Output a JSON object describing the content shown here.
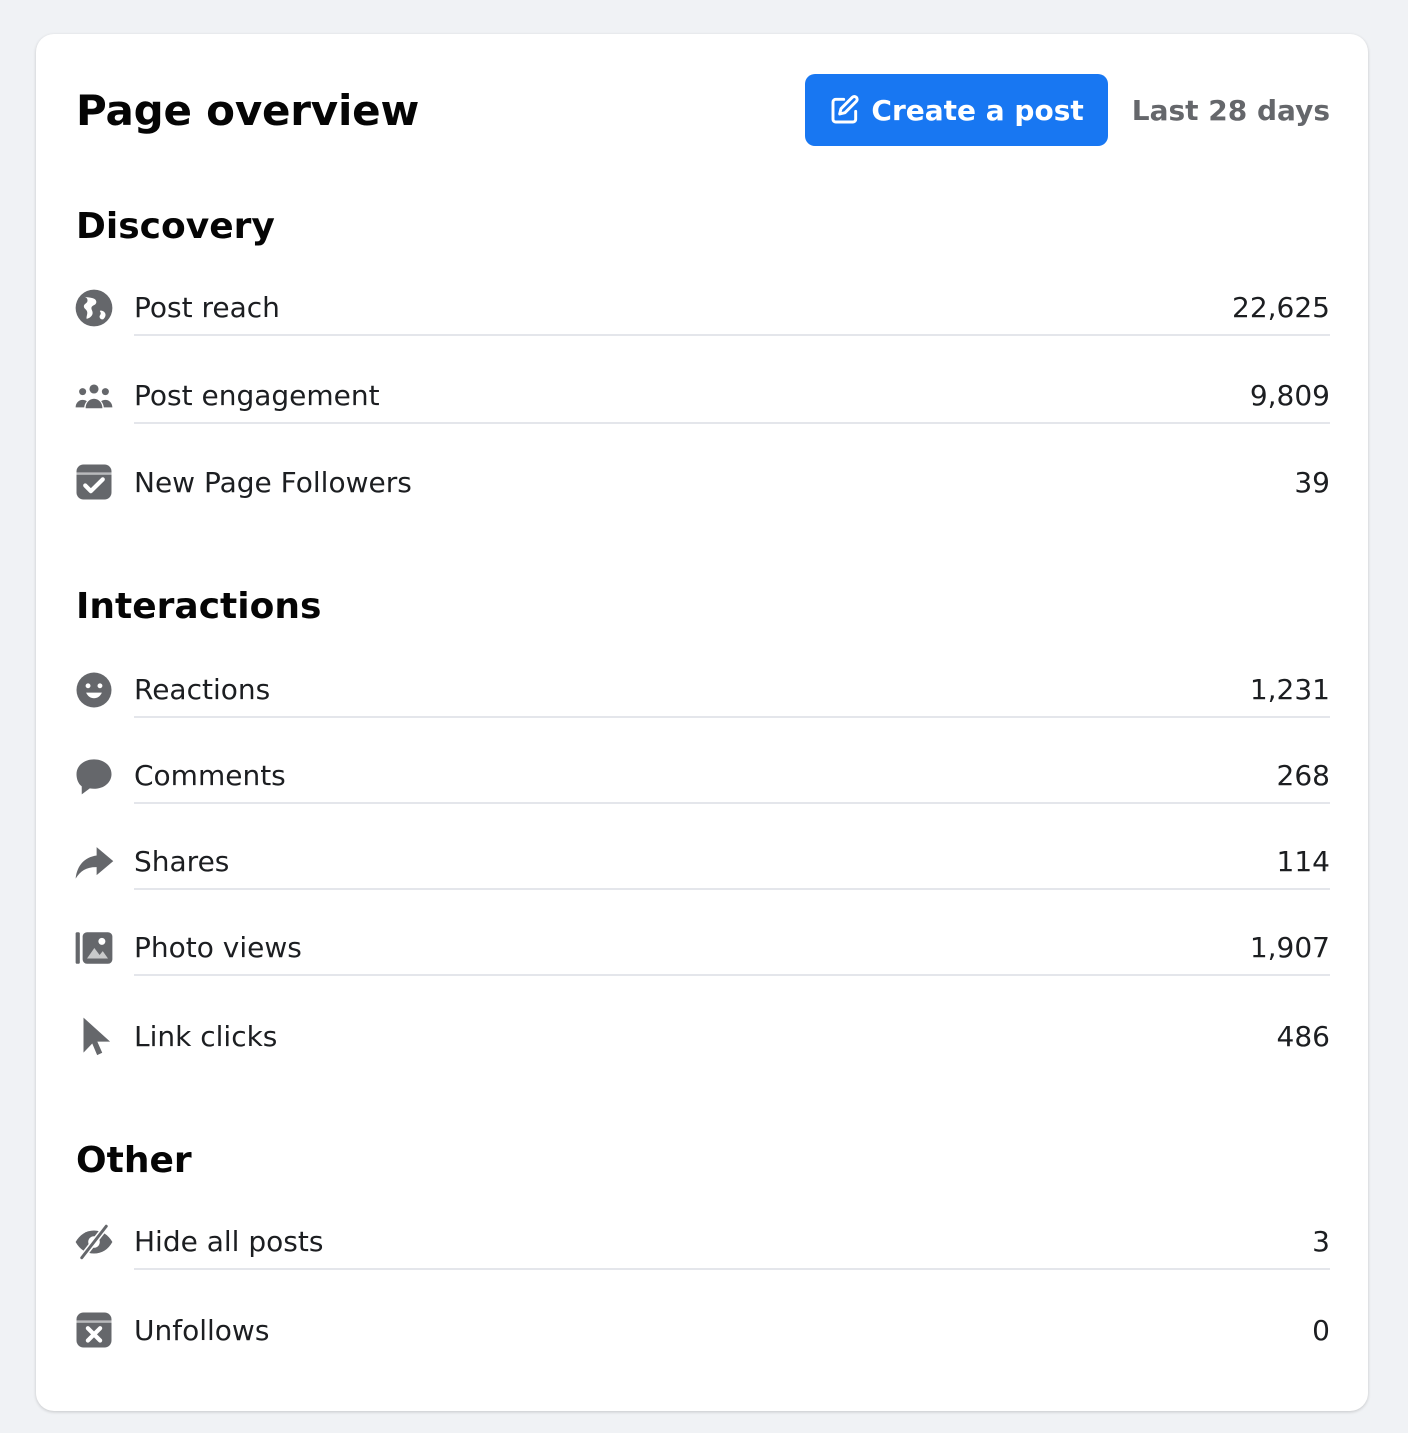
{
  "header": {
    "title": "Page overview",
    "create_label": "Create a post",
    "range_label": "Last 28 days"
  },
  "colors": {
    "accent": "#1877f2",
    "icon": "#65676b",
    "divider": "#e4e6eb"
  },
  "sections": {
    "discovery": {
      "title": "Discovery",
      "rows": [
        {
          "label": "Post reach",
          "value": "22,625",
          "icon": "globe-icon"
        },
        {
          "label": "Post engagement",
          "value": "9,809",
          "icon": "people-icon"
        },
        {
          "label": "New Page Followers",
          "value": "39",
          "icon": "follow-check-icon"
        }
      ]
    },
    "interactions": {
      "title": "Interactions",
      "rows": [
        {
          "label": "Reactions",
          "value": "1,231",
          "icon": "smiley-icon"
        },
        {
          "label": "Comments",
          "value": "268",
          "icon": "comment-icon"
        },
        {
          "label": "Shares",
          "value": "114",
          "icon": "share-arrow-icon"
        },
        {
          "label": "Photo views",
          "value": "1,907",
          "icon": "photo-icon"
        },
        {
          "label": "Link clicks",
          "value": "486",
          "icon": "cursor-icon"
        }
      ]
    },
    "other": {
      "title": "Other",
      "rows": [
        {
          "label": "Hide all posts",
          "value": "3",
          "icon": "eye-slash-icon"
        },
        {
          "label": "Unfollows",
          "value": "0",
          "icon": "unfollow-x-icon"
        }
      ]
    }
  }
}
